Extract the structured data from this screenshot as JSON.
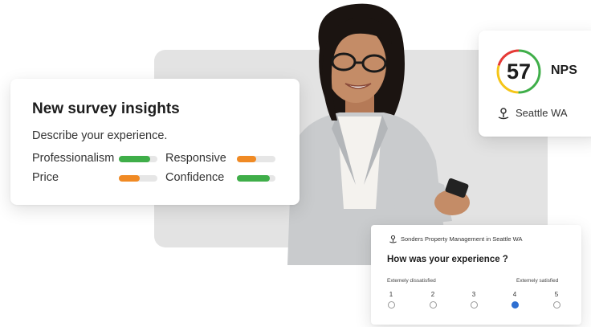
{
  "insights": {
    "title": "New survey insights",
    "subtitle": "Describe your experience.",
    "metrics": [
      {
        "label": "Professionalism",
        "level": 0.82,
        "color": "#3fae49"
      },
      {
        "label": "Responsive",
        "level": 0.5,
        "color": "#f08a24"
      },
      {
        "label": "Price",
        "level": 0.55,
        "color": "#f08a24"
      },
      {
        "label": "Confidence",
        "level": 0.85,
        "color": "#3fae49"
      }
    ]
  },
  "nps": {
    "score": "57",
    "label": "NPS",
    "location": "Seattle WA",
    "ring_colors": [
      "#3fae49",
      "#f5c518",
      "#e53935"
    ]
  },
  "survey": {
    "header": "Sonders Property Management in Seattle WA",
    "question": "How was your experience ?",
    "scale_low": "Extemely dissatisfied",
    "scale_high": "Extemely satisfied",
    "options": [
      "1",
      "2",
      "3",
      "4",
      "5"
    ],
    "selected": "4",
    "accent": "#2e6fd1"
  }
}
